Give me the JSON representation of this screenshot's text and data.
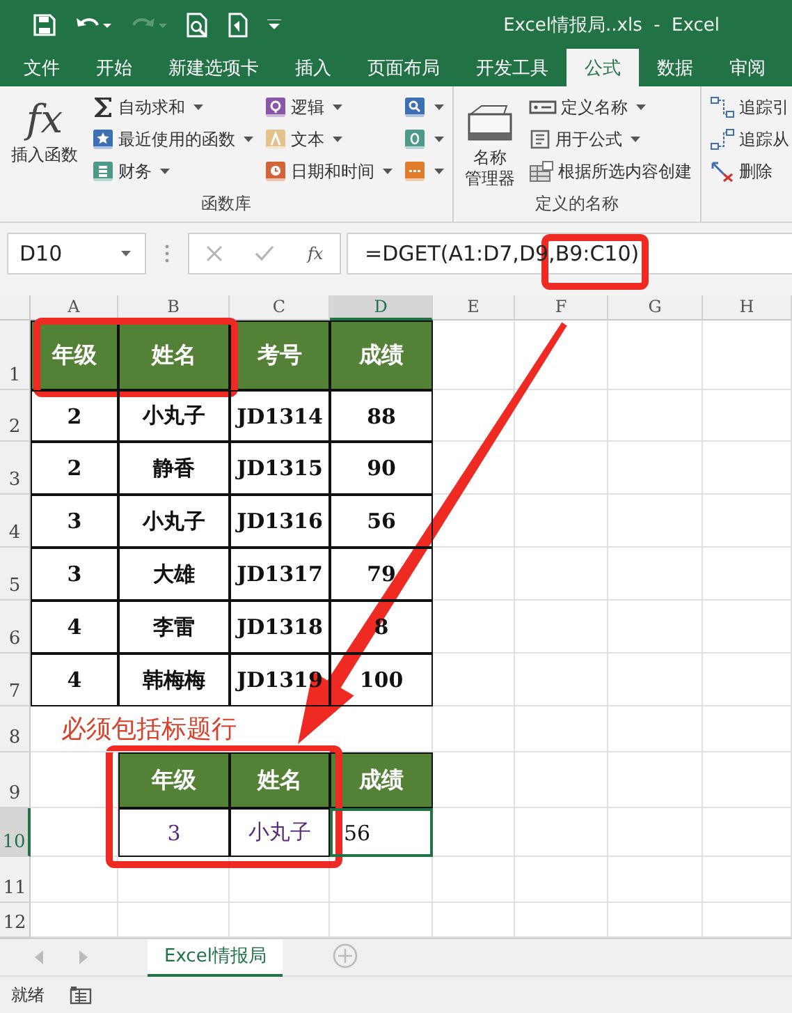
{
  "title_bar": {
    "title": "Excel情报局..xls  -  Excel"
  },
  "ribbon_tabs": [
    {
      "label": "文件",
      "selected": false
    },
    {
      "label": "开始",
      "selected": false
    },
    {
      "label": "新建选项卡",
      "selected": false
    },
    {
      "label": "插入",
      "selected": false
    },
    {
      "label": "页面布局",
      "selected": false
    },
    {
      "label": "开发工具",
      "selected": false
    },
    {
      "label": "公式",
      "selected": true
    },
    {
      "label": "数据",
      "selected": false
    },
    {
      "label": "审阅",
      "selected": false
    }
  ],
  "ribbon_groups": [
    {
      "label": "函数库",
      "items": [
        {
          "kind": "large",
          "glyph": "fx",
          "lines": [
            "插入函数"
          ]
        },
        {
          "kind": "small",
          "label": "自动求和",
          "dropdown": true
        },
        {
          "kind": "small",
          "label": "最近使用的函数",
          "dropdown": true
        },
        {
          "kind": "small",
          "label": "财务",
          "dropdown": true
        },
        {
          "kind": "small",
          "label": "逻辑",
          "dropdown": true
        },
        {
          "kind": "small",
          "label": "文本",
          "dropdown": true
        },
        {
          "kind": "small",
          "label": "日期和时间",
          "dropdown": true
        },
        {
          "kind": "icon",
          "dropdown": true
        },
        {
          "kind": "icon",
          "dropdown": true
        },
        {
          "kind": "icon",
          "dropdown": true
        }
      ]
    },
    {
      "label": "定义的名称",
      "items": [
        {
          "kind": "large",
          "lines": [
            "名称",
            "管理器"
          ]
        },
        {
          "kind": "small",
          "label": "定义名称",
          "dropdown": true
        },
        {
          "kind": "small",
          "label": "用于公式",
          "dropdown": true
        },
        {
          "kind": "small",
          "label": "根据所选内容创建",
          "dropdown": false
        }
      ]
    },
    {
      "items": [
        {
          "kind": "small",
          "label": "追踪引",
          "dropdown": false
        },
        {
          "kind": "small",
          "label": "追踪从",
          "dropdown": false
        },
        {
          "kind": "small",
          "label": "删除",
          "dropdown": false
        }
      ]
    }
  ],
  "formula_bar": {
    "name_box": "D10",
    "fx": "fx",
    "formula": "=DGET(A1:D7,D9,B9:C10)"
  },
  "columns": [
    {
      "label": "A",
      "selected": false
    },
    {
      "label": "B",
      "selected": false
    },
    {
      "label": "C",
      "selected": false
    },
    {
      "label": "D",
      "selected": true
    },
    {
      "label": "E",
      "selected": false
    },
    {
      "label": "F",
      "selected": false
    },
    {
      "label": "G",
      "selected": false
    },
    {
      "label": "H",
      "selected": false
    }
  ],
  "rows": [
    {
      "number": "1",
      "selected": false,
      "cells": [
        {
          "text": "年级",
          "kind": "header"
        },
        {
          "text": "姓名",
          "kind": "header"
        },
        {
          "text": "考号",
          "kind": "header"
        },
        {
          "text": "成绩",
          "kind": "header"
        },
        null,
        null,
        null,
        null
      ]
    },
    {
      "number": "2",
      "selected": false,
      "cells": [
        {
          "text": "2",
          "kind": "data"
        },
        {
          "text": "小丸子",
          "kind": "data"
        },
        {
          "text": "JD1314",
          "kind": "data"
        },
        {
          "text": "88",
          "kind": "data"
        },
        null,
        null,
        null,
        null
      ]
    },
    {
      "number": "3",
      "selected": false,
      "cells": [
        {
          "text": "2",
          "kind": "data"
        },
        {
          "text": "静香",
          "kind": "data"
        },
        {
          "text": "JD1315",
          "kind": "data"
        },
        {
          "text": "90",
          "kind": "data"
        },
        null,
        null,
        null,
        null
      ]
    },
    {
      "number": "4",
      "selected": false,
      "cells": [
        {
          "text": "3",
          "kind": "data"
        },
        {
          "text": "小丸子",
          "kind": "data"
        },
        {
          "text": "JD1316",
          "kind": "data"
        },
        {
          "text": "56",
          "kind": "data"
        },
        null,
        null,
        null,
        null
      ]
    },
    {
      "number": "5",
      "selected": false,
      "cells": [
        {
          "text": "3",
          "kind": "data"
        },
        {
          "text": "大雄",
          "kind": "data"
        },
        {
          "text": "JD1317",
          "kind": "data"
        },
        {
          "text": "79",
          "kind": "data"
        },
        null,
        null,
        null,
        null
      ]
    },
    {
      "number": "6",
      "selected": false,
      "cells": [
        {
          "text": "4",
          "kind": "data"
        },
        {
          "text": "李雷",
          "kind": "data"
        },
        {
          "text": "JD1318",
          "kind": "data"
        },
        {
          "text": "8",
          "kind": "data"
        },
        null,
        null,
        null,
        null
      ]
    },
    {
      "number": "7",
      "selected": false,
      "cells": [
        {
          "text": "4",
          "kind": "data"
        },
        {
          "text": "韩梅梅",
          "kind": "data"
        },
        {
          "text": "JD1319",
          "kind": "data"
        },
        {
          "text": "100",
          "kind": "data"
        },
        null,
        null,
        null,
        null
      ]
    },
    {
      "number": "8",
      "selected": false,
      "cells": [
        {
          "text": "必须包括标题行",
          "kind": "note"
        },
        null,
        null,
        null,
        null,
        null,
        null,
        null
      ]
    },
    {
      "number": "9",
      "selected": false,
      "cells": [
        null,
        {
          "text": "年级",
          "kind": "header"
        },
        {
          "text": "姓名",
          "kind": "header"
        },
        {
          "text": "成绩",
          "kind": "header"
        },
        null,
        null,
        null,
        null
      ]
    },
    {
      "number": "10",
      "selected": true,
      "cells": [
        null,
        {
          "text": "3",
          "kind": "criteria"
        },
        {
          "text": "小丸子",
          "kind": "criteria"
        },
        {
          "text": "56",
          "kind": "result"
        },
        null,
        null,
        null,
        null
      ]
    },
    {
      "number": "11",
      "selected": false,
      "cells": [
        null,
        null,
        null,
        null,
        null,
        null,
        null,
        null
      ]
    },
    {
      "number": "12",
      "selected": false,
      "cells": [
        null,
        null,
        null,
        null,
        null,
        null,
        null,
        null
      ]
    }
  ],
  "highlights": [
    {
      "kind": "box"
    },
    {
      "kind": "box"
    },
    {
      "kind": "box"
    },
    {
      "kind": "arrow"
    }
  ],
  "sheet_tabs": [
    {
      "label": "Excel情报局",
      "selected": true
    }
  ],
  "status_bar": {
    "text": "就绪"
  }
}
